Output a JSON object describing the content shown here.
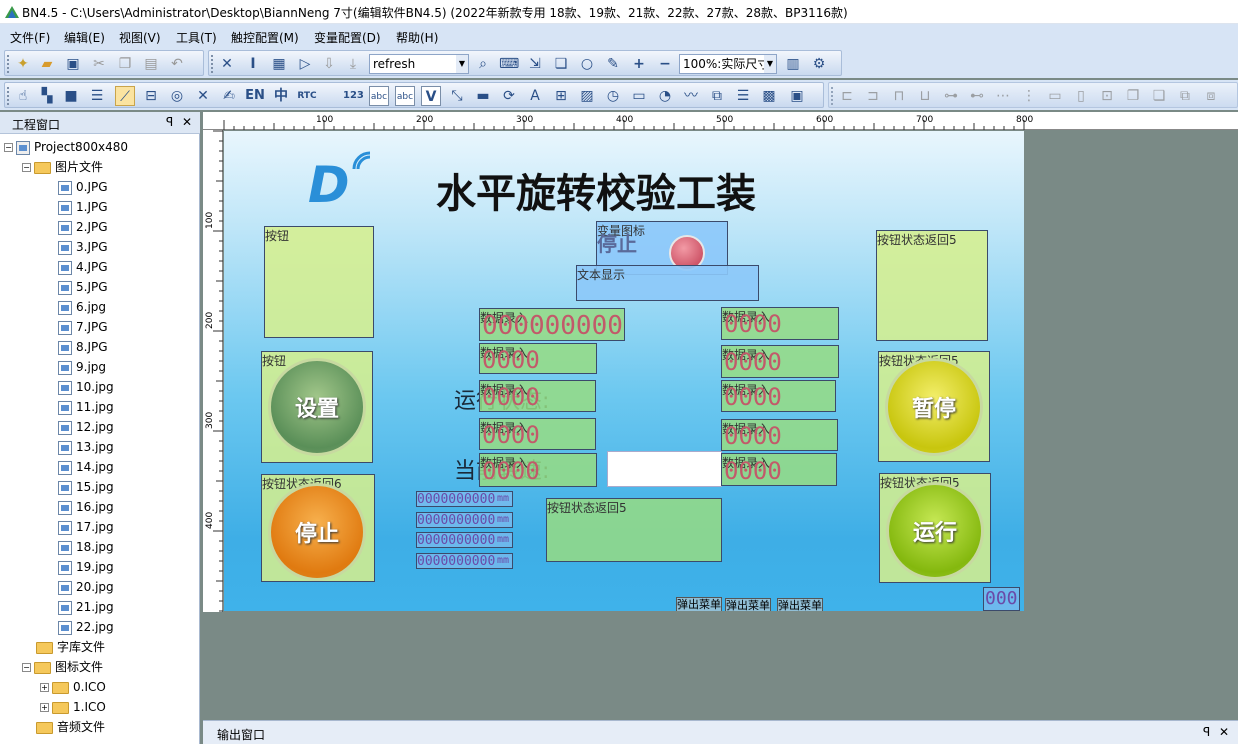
{
  "window": {
    "title": "BN4.5 - C:\\Users\\Administrator\\Desktop\\BiannNeng 7寸(编辑软件BN4.5) (2022年新款专用 18款、19款、21款、22款、27款、28款、BP3116款)"
  },
  "menu": [
    "文件(F)",
    "编辑(E)",
    "视图(V)",
    "工具(T)",
    "触控配置(M)",
    "变量配置(D)",
    "帮助(H)"
  ],
  "toolbar": {
    "font_combo": "refresh",
    "zoom_combo": "100%:实际尺寸",
    "lang_en": "EN",
    "lang_zh": "中",
    "rtc": "RTC",
    "num_123": "123",
    "abc1": "abc",
    "abc2": "abc",
    "v_label": "V"
  },
  "project_panel": {
    "title": "工程窗口",
    "pin": "ꟼ",
    "close": "✕",
    "root": "Project800x480",
    "folders": {
      "images": "图片文件",
      "fonts": "字库文件",
      "icons": "图标文件",
      "audio": "音频文件"
    },
    "image_files": [
      "0.JPG",
      "1.JPG",
      "2.JPG",
      "3.JPG",
      "4.JPG",
      "5.JPG",
      "6.jpg",
      "7.JPG",
      "8.JPG",
      "9.jpg",
      "10.jpg",
      "11.jpg",
      "12.jpg",
      "13.jpg",
      "14.jpg",
      "15.jpg",
      "16.jpg",
      "17.jpg",
      "18.jpg",
      "19.jpg",
      "20.jpg",
      "21.jpg",
      "22.jpg"
    ],
    "icon_files": [
      "0.ICO",
      "1.ICO"
    ]
  },
  "ruler": {
    "h_ticks": [
      "100",
      "200",
      "300",
      "400",
      "500",
      "600",
      "700",
      "800"
    ],
    "v_ticks": [
      "100",
      "200",
      "300",
      "400"
    ]
  },
  "screen": {
    "title": "水平旋转校验工装",
    "logo": "D",
    "state_text1": "运行状态:",
    "state_text2": "当前转速:",
    "var_icon_label": "变量图标",
    "var_icon_stop": "停止",
    "text_display_label": "文本显示",
    "button_label": "按钮",
    "btn_status5": "按钮状态返回5",
    "btn_status6": "按钮状态返回6",
    "data_entry": "数据录入",
    "big_zero": "000000000",
    "zero4": "0000",
    "zero11": "0000000000",
    "unit": "mm",
    "corner_zero": "000",
    "btn_set": "设置",
    "btn_pause": "暂停",
    "btn_stop": "停止",
    "btn_run": "运行",
    "menu_popups": [
      "弹出菜单",
      "弹出菜单",
      "弹出菜单"
    ]
  },
  "output_panel": {
    "title": "输出窗口",
    "pin": "ꟼ",
    "close": "✕"
  }
}
